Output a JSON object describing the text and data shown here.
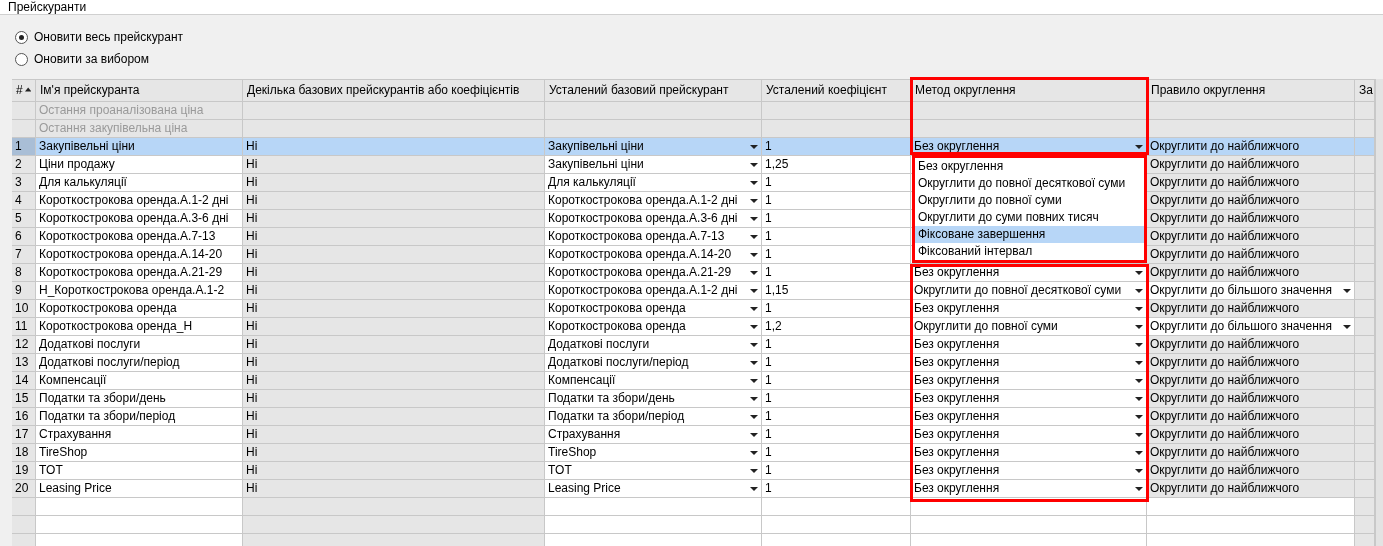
{
  "window": {
    "title": "Прейскуранти"
  },
  "update_mode": [
    {
      "label": "Оновити весь прейскурант",
      "selected": true
    },
    {
      "label": "Оновити за вибором",
      "selected": false
    }
  ],
  "table": {
    "columns": [
      "#",
      "Ім'я прейскуранта",
      "Декілька базових прейскурантів або коефіцієнтів",
      "Усталений базовий прейскурант",
      "Усталений коефіцієнт",
      "Метод округлення",
      "Правило округлення",
      "За"
    ],
    "special_rows": [
      "Остання проаналізована ціна",
      "Остання закупівельна ціна"
    ],
    "rows": [
      {
        "number": "1",
        "name": "Закупівельні ціни",
        "multiple": "Ні",
        "base": "Закупівельні ціни",
        "coefficient": "1",
        "method": "Без округлення",
        "rule": "Округлити до найближчого",
        "rule_dropdown": false,
        "selected": true
      },
      {
        "number": "2",
        "name": "Ціни продажу",
        "multiple": "Ні",
        "base": "Закупівельні ціни",
        "coefficient": "1,25",
        "rule": "Округлити до найближчого",
        "rule_dropdown": false,
        "selected": false
      },
      {
        "number": "3",
        "name": "Для калькуляції",
        "multiple": "Ні",
        "base": "Для калькуляції",
        "coefficient": "1",
        "rule": "Округлити до найближчого",
        "rule_dropdown": false,
        "selected": false
      },
      {
        "number": "4",
        "name": "Короткострокова оренда.А.1-2 дні",
        "multiple": "Ні",
        "base": "Короткострокова оренда.А.1-2 дні",
        "coefficient": "1",
        "rule": "Округлити до найближчого",
        "rule_dropdown": false,
        "selected": false
      },
      {
        "number": "5",
        "name": "Короткострокова оренда.А.3-6 дні",
        "multiple": "Ні",
        "base": "Короткострокова оренда.А.3-6 дні",
        "coefficient": "1",
        "rule": "Округлити до найближчого",
        "rule_dropdown": false,
        "selected": false
      },
      {
        "number": "6",
        "name": "Короткострокова оренда.А.7-13",
        "multiple": "Ні",
        "base": "Короткострокова оренда.А.7-13",
        "coefficient": "1",
        "rule": "Округлити до найближчого",
        "rule_dropdown": false,
        "selected": false
      },
      {
        "number": "7",
        "name": "Короткострокова оренда.А.14-20",
        "multiple": "Ні",
        "base": "Короткострокова оренда.А.14-20",
        "coefficient": "1",
        "rule": "Округлити до найближчого",
        "rule_dropdown": false,
        "selected": false
      },
      {
        "number": "8",
        "name": "Короткострокова оренда.А.21-29",
        "multiple": "Ні",
        "base": "Короткострокова оренда.А.21-29",
        "coefficient": "1",
        "method": "Без округлення",
        "rule": "Округлити до найближчого",
        "rule_dropdown": false,
        "selected": false
      },
      {
        "number": "9",
        "name": "Н_Короткострокова оренда.А.1-2",
        "multiple": "Ні",
        "base": "Короткострокова оренда.А.1-2 дні",
        "coefficient": "1,15",
        "method": "Округлити до повної десяткової суми",
        "rule": "Округлити до більшого значення",
        "rule_dropdown": true,
        "selected": false
      },
      {
        "number": "10",
        "name": "Короткострокова оренда",
        "multiple": "Ні",
        "base": "Короткострокова оренда",
        "coefficient": "1",
        "method": "Без округлення",
        "rule": "Округлити до найближчого",
        "rule_dropdown": false,
        "selected": false
      },
      {
        "number": "11",
        "name": "Короткострокова оренда_Н",
        "multiple": "Ні",
        "base": "Короткострокова оренда",
        "coefficient": "1,2",
        "method": "Округлити до повної суми",
        "rule": "Округлити до більшого значення",
        "rule_dropdown": true,
        "selected": false
      },
      {
        "number": "12",
        "name": "Додаткові послуги",
        "multiple": "Ні",
        "base": "Додаткові послуги",
        "coefficient": "1",
        "method": "Без округлення",
        "rule": "Округлити до найближчого",
        "rule_dropdown": false,
        "selected": false
      },
      {
        "number": "13",
        "name": "Додаткові послуги/період",
        "multiple": "Ні",
        "base": "Додаткові послуги/період",
        "coefficient": "1",
        "method": "Без округлення",
        "rule": "Округлити до найближчого",
        "rule_dropdown": false,
        "selected": false
      },
      {
        "number": "14",
        "name": "Компенсації",
        "multiple": "Ні",
        "base": "Компенсації",
        "coefficient": "1",
        "method": "Без округлення",
        "rule": "Округлити до найближчого",
        "rule_dropdown": false,
        "selected": false
      },
      {
        "number": "15",
        "name": "Податки та збори/день",
        "multiple": "Ні",
        "base": "Податки та збори/день",
        "coefficient": "1",
        "method": "Без округлення",
        "rule": "Округлити до найближчого",
        "rule_dropdown": false,
        "selected": false
      },
      {
        "number": "16",
        "name": "Податки та збори/період",
        "multiple": "Ні",
        "base": "Податки та збори/період",
        "coefficient": "1",
        "method": "Без округлення",
        "rule": "Округлити до найближчого",
        "rule_dropdown": false,
        "selected": false
      },
      {
        "number": "17",
        "name": "Страхування",
        "multiple": "Ні",
        "base": "Страхування",
        "coefficient": "1",
        "method": "Без округлення",
        "rule": "Округлити до найближчого",
        "rule_dropdown": false,
        "selected": false
      },
      {
        "number": "18",
        "name": "TireShop",
        "multiple": "Ні",
        "base": "TireShop",
        "coefficient": "1",
        "method": "Без округлення",
        "rule": "Округлити до найближчого",
        "rule_dropdown": false,
        "selected": false
      },
      {
        "number": "19",
        "name": "TOT",
        "multiple": "Ні",
        "base": "TOT",
        "coefficient": "1",
        "method": "Без округлення",
        "rule": "Округлити до найближчого",
        "rule_dropdown": false,
        "selected": false
      },
      {
        "number": "20",
        "name": "Leasing Price",
        "multiple": "Ні",
        "base": "Leasing Price",
        "coefficient": "1",
        "method": "Без округлення",
        "rule": "Округлити до найближчого",
        "rule_dropdown": false,
        "selected": false
      }
    ]
  },
  "method_dropdown": {
    "options": [
      {
        "label": "Без округлення",
        "selected": false
      },
      {
        "label": "Округлити до повної десяткової суми",
        "selected": false
      },
      {
        "label": "Округлити до повної суми",
        "selected": false
      },
      {
        "label": "Округлити до суми повних тисяч",
        "selected": false
      },
      {
        "label": "Фіксоване завершення",
        "selected": true
      },
      {
        "label": "Фіксований інтервал",
        "selected": false
      }
    ]
  }
}
